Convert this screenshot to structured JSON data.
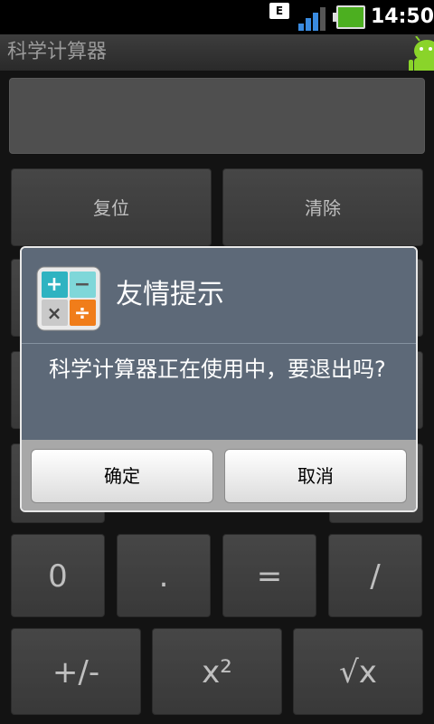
{
  "status_bar": {
    "network_type": "E",
    "time": "14:50"
  },
  "app": {
    "title": "科学计算器"
  },
  "calculator": {
    "row1": [
      "复位",
      "清除"
    ],
    "row_bottom1": [
      "0",
      ".",
      "=",
      "/"
    ],
    "row_bottom2": [
      "+/-",
      "x²",
      "√x"
    ]
  },
  "dialog": {
    "title": "友情提示",
    "message": "科学计算器正在使用中，要退出吗?",
    "confirm_label": "确定",
    "cancel_label": "取消",
    "icon_symbols": [
      "+",
      "−",
      "×",
      "÷"
    ]
  },
  "colors": {
    "accent": "#5d6978",
    "battery": "#4caf20",
    "signal": "#3a8be0"
  }
}
